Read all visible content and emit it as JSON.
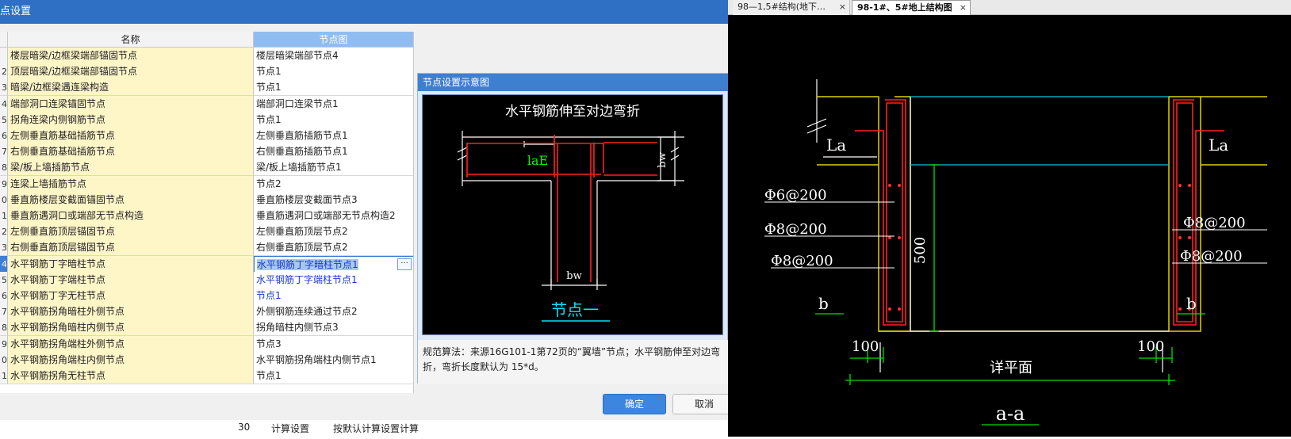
{
  "dialog": {
    "title": "点设置",
    "columns": {
      "name": "名称",
      "node": "节点图"
    },
    "rows": [
      {
        "num": "",
        "name": "楼层暗梁/边框梁端部锚固节点",
        "node": "楼层暗梁端部节点4"
      },
      {
        "num": "2",
        "name": "顶层暗梁/边框梁端部锚固节点",
        "node": "节点1"
      },
      {
        "num": "3",
        "name": "暗梁/边框梁遇连梁构造",
        "node": "节点1"
      },
      {
        "num": "4",
        "name": "端部洞口连梁锚固节点",
        "node": "端部洞口连梁节点1"
      },
      {
        "num": "5",
        "name": "拐角连梁内侧钢筋节点",
        "node": "节点1"
      },
      {
        "num": "6",
        "name": "左侧垂直筋基础插筋节点",
        "node": "左侧垂直筋插筋节点1"
      },
      {
        "num": "7",
        "name": "右侧垂直筋基础插筋节点",
        "node": "右侧垂直筋插筋节点1"
      },
      {
        "num": "8",
        "name": "梁/板上墙插筋节点",
        "node": "梁/板上墙插筋节点1"
      },
      {
        "num": "9",
        "name": "连梁上墙插筋节点",
        "node": "节点2"
      },
      {
        "num": "0",
        "name": "垂直筋楼层变截面锚固节点",
        "node": "垂直筋楼层变截面节点3"
      },
      {
        "num": "1",
        "name": "垂直筋遇洞口或端部无节点构造",
        "node": "垂直筋遇洞口或端部无节点构造2"
      },
      {
        "num": "2",
        "name": "左侧垂直筋顶层锚固节点",
        "node": "左侧垂直筋顶层节点2"
      },
      {
        "num": "3",
        "name": "右侧垂直筋顶层锚固节点",
        "node": "右侧垂直筋顶层节点2"
      },
      {
        "num": "4",
        "name": "水平钢筋丁字暗柱节点",
        "node": "水平钢筋丁字暗柱节点1",
        "selected": true
      },
      {
        "num": "5",
        "name": "水平钢筋丁字端柱节点",
        "node": "水平钢筋丁字端柱节点1",
        "blue": true
      },
      {
        "num": "6",
        "name": "水平钢筋丁字无柱节点",
        "node": "节点1",
        "blue": true
      },
      {
        "num": "7",
        "name": "水平钢筋拐角暗柱外侧节点",
        "node": "外侧钢筋连续通过节点2"
      },
      {
        "num": "8",
        "name": "水平钢筋拐角暗柱内侧节点",
        "node": "拐角暗柱内侧节点3"
      },
      {
        "num": "9",
        "name": "水平钢筋拐角端柱外侧节点",
        "node": "节点3"
      },
      {
        "num": "0",
        "name": "水平钢筋拐角端柱内侧节点",
        "node": "水平钢筋拐角端柱内侧节点1"
      },
      {
        "num": "1",
        "name": "水平钢筋拐角无柱节点",
        "node": "节点1"
      }
    ],
    "preview": {
      "title": "节点设置示意图",
      "diagram_title": "水平钢筋伸至对边弯折",
      "label_lae": "laE",
      "label_bw_top": "bw",
      "label_bw_bottom": "bw",
      "caption": "节点一",
      "description": "规范算法：来源16G101-1第72页的“翼墙”节点；水平钢筋伸至对边弯折，弯折长度默认为 15*d。"
    },
    "ok_label": "确定",
    "cancel_label": "取消"
  },
  "background": {
    "row_num": "30",
    "item1": "计算设置",
    "item2": "按默认计算设置计算"
  },
  "cad": {
    "tabs": [
      {
        "label": "98—1,5#结构(地下…",
        "close": "×"
      },
      {
        "label": "98-1#、5#地上结构图",
        "close": "×"
      }
    ],
    "labels": {
      "la_left": "La",
      "la_right": "La",
      "bar1": "Φ6@200",
      "bar2": "Φ8@200",
      "bar3": "Φ8@200",
      "bar_r1": "Φ8@200",
      "bar_r2": "Φ8@200",
      "dim_500": "500",
      "b_left": "b",
      "b_right": "b",
      "dim_100_left": "100",
      "dim_100_right": "100",
      "plan_note": "详平面",
      "section": "a-a"
    }
  }
}
